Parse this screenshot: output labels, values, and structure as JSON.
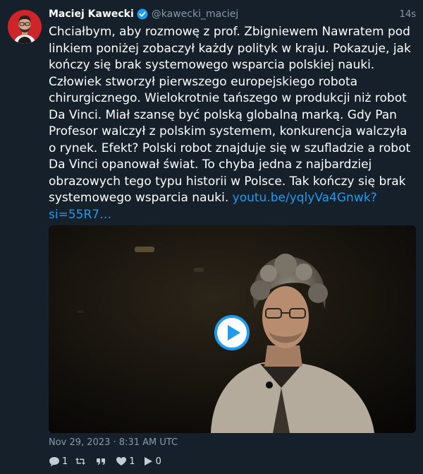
{
  "tweet": {
    "author_name": "Maciej Kawecki",
    "handle": "@kawecki_maciej",
    "time_ago": "14s",
    "text": "Chciałbym, aby rozmowę z prof. Zbigniewem Nawratem pod linkiem poniżej zobaczył każdy polityk w kraju. Pokazuje, jak kończy się brak systemowego wsparcia polskiej nauki. Człowiek stworzył pierwszego europejskiego robota chirurgicznego. Wielokrotnie tańszego w produkcji niż robot Da Vinci. Miał szansę być polską globalną marką. Gdy Pan Profesor walczył z polskim systemem, konkurencja walczyła o rynek. Efekt? Polski robot znajduje się w szufladzie a robot Da Vinci opanował świat. To chyba jedna z najbardziej obrazowych tego typu historii w Polsce. Tak kończy się brak systemowego wsparcia nauki. ",
    "link": "youtu.be/yqlyVa4Gnwk?si=55R7…",
    "date": "Nov 29, 2023 · 8:31 AM UTC",
    "stats": {
      "replies": "1",
      "retweets": "",
      "quotes": "",
      "likes": "1",
      "views": "0"
    }
  },
  "colors": {
    "background": "#15202b",
    "text": "#ffffff",
    "muted": "#8899a6",
    "link": "#1d9bf0",
    "verified": "#1d9bf0",
    "avatar_bg": "#d0242b"
  },
  "icons": {
    "verified": "verified-badge-icon",
    "reply": "reply-icon",
    "retweet": "retweet-icon",
    "quote": "quote-icon",
    "like": "heart-icon",
    "views": "play-icon",
    "video": "video-play-icon"
  }
}
